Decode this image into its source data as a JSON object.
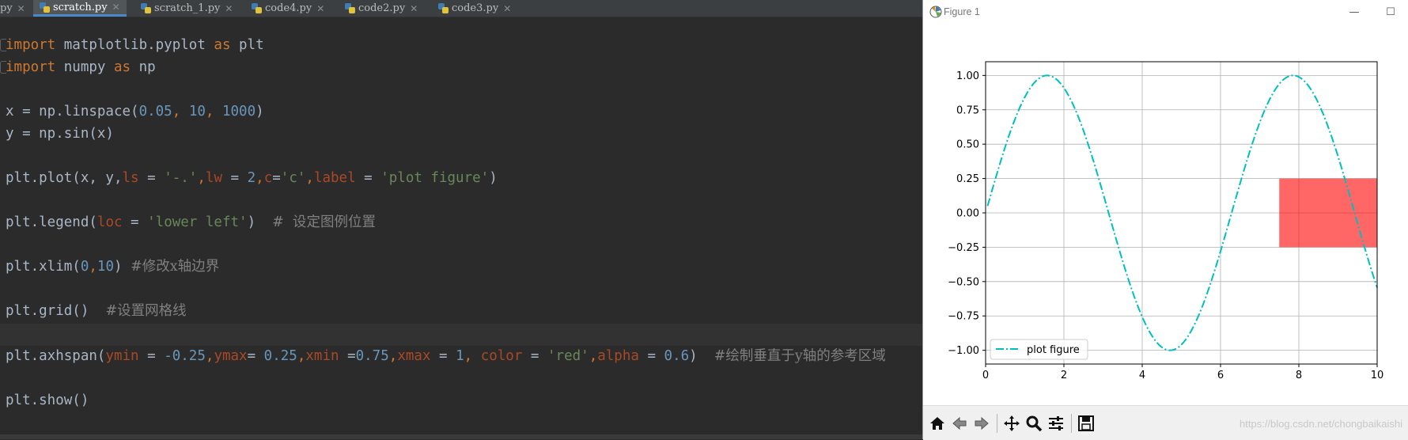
{
  "ide": {
    "tabs": [
      {
        "label": "py"
      },
      {
        "label": "scratch.py"
      },
      {
        "label": "scratch_1.py"
      },
      {
        "label": "code4.py"
      },
      {
        "label": "code2.py"
      },
      {
        "label": "code3.py"
      }
    ],
    "code": {
      "l1_kw1": "import",
      "l1_mod": " matplotlib.pyplot ",
      "l1_kw2": "as",
      "l1_alias": " plt",
      "l2_kw1": "import",
      "l2_mod": " numpy ",
      "l2_kw2": "as",
      "l2_alias": " np",
      "l3_pre": "x = np.linspace(",
      "l3_n1": "0.05",
      "l3_c1": ", ",
      "l3_n2": "10",
      "l3_c2": ", ",
      "l3_n3": "1000",
      "l3_post": ")",
      "l4": "y = np.sin(x)",
      "l5_pre": "plt.plot(x, y,",
      "l5_p1": "ls",
      "l5_eq1": " = ",
      "l5_s1": "'-.'",
      "l5_c1": ",",
      "l5_p2": "lw",
      "l5_eq2": " = ",
      "l5_n2": "2",
      "l5_c2": ",",
      "l5_p3": "c",
      "l5_eq3": "=",
      "l5_s3": "'c'",
      "l5_c3": ",",
      "l5_p4": "label",
      "l5_eq4": " = ",
      "l5_s4": "'plot figure'",
      "l5_post": ")",
      "l6_pre": "plt.legend(",
      "l6_p1": "loc",
      "l6_eq1": " = ",
      "l6_s1": "'lower left'",
      "l6_post": ")  ",
      "l6_cmt": "#  设定图例位置",
      "l7_pre": "plt.xlim(",
      "l7_n1": "0",
      "l7_c1": ",",
      "l7_n2": "10",
      "l7_post": ") ",
      "l7_cmt": "#修改x轴边界",
      "l8_pre": "plt.grid()  ",
      "l8_cmt": "#设置网格线",
      "l9_pre": "plt.axhspan(",
      "l9_p1": "ymin",
      "l9_eq1": " = ",
      "l9_n1": "-0.25",
      "l9_c1": ",",
      "l9_p2": "ymax",
      "l9_eq2": "= ",
      "l9_n2": "0.25",
      "l9_c2": ",",
      "l9_p3": "xmin",
      "l9_eq3": " =",
      "l9_n3": "0.75",
      "l9_c3": ",",
      "l9_p4": "xmax",
      "l9_eq4": " = ",
      "l9_n4": "1",
      "l9_c4": ", ",
      "l9_p5": "color",
      "l9_eq5": " = ",
      "l9_s5": "'red'",
      "l9_c5": ",",
      "l9_p6": "alpha",
      "l9_eq6": " = ",
      "l9_n6": "0.6",
      "l9_post": ")  ",
      "l9_cmt": "#绘制垂直于y轴的参考区域",
      "l10": "plt.show()"
    }
  },
  "figure_window": {
    "title": "Figure 1",
    "min_glyph": "—",
    "max_glyph": "☐",
    "close_glyph": "✕",
    "watermark": "https://blog.csdn.net/chongbaikaishi",
    "toolbar": [
      "home-icon",
      "back-icon",
      "forward-icon",
      "pan-icon",
      "zoom-icon",
      "configure-icon",
      "save-icon"
    ]
  },
  "chart_data": {
    "type": "line",
    "title": "",
    "xlabel": "",
    "ylabel": "",
    "xlim": [
      0,
      10
    ],
    "ylim": [
      -1.1,
      1.1
    ],
    "grid": true,
    "x_ticks": [
      "0",
      "2",
      "4",
      "6",
      "8",
      "10"
    ],
    "y_ticks": [
      "−1.00",
      "−0.75",
      "−0.50",
      "−0.25",
      "0.00",
      "0.25",
      "0.50",
      "0.75",
      "1.00"
    ],
    "series": [
      {
        "name": "plot figure",
        "function": "sin(x)",
        "x": [
          0.05,
          0.5,
          1.0,
          1.571,
          2.0,
          2.5,
          3.0,
          3.5,
          4.0,
          4.712,
          5.0,
          5.5,
          6.0,
          6.5,
          7.0,
          7.854,
          8.5,
          9.0,
          9.5,
          10.0
        ],
        "y": [
          0.05,
          0.48,
          0.84,
          1.0,
          0.91,
          0.6,
          0.14,
          -0.35,
          -0.76,
          -1.0,
          -0.96,
          -0.71,
          -0.28,
          0.22,
          0.66,
          1.0,
          0.8,
          0.41,
          -0.08,
          -0.54
        ],
        "color": "#00bfbf",
        "linestyle": "dashdot",
        "linewidth": 2
      }
    ],
    "axhspan": {
      "ymin": -0.25,
      "ymax": 0.25,
      "xmin": 0.75,
      "xmax": 1,
      "color": "#ff0000",
      "alpha": 0.6
    },
    "legend": {
      "entries": [
        "plot figure"
      ],
      "placement": "lower left"
    }
  }
}
